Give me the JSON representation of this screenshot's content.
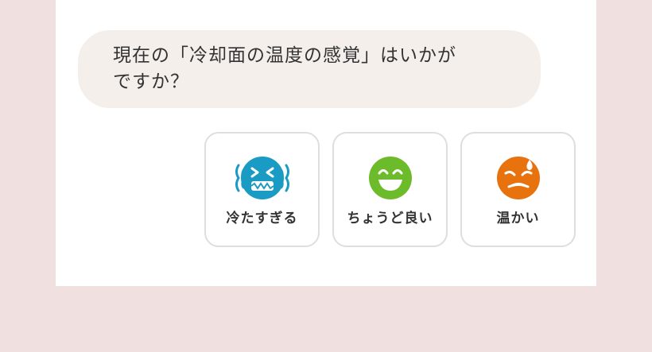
{
  "question": {
    "line1": "現在の「冷却面の温度の感覚」はいかが",
    "line2": "ですか？"
  },
  "options": [
    {
      "label": "冷たすぎる",
      "icon": "freezing-face-icon",
      "color": "#1a9bc4"
    },
    {
      "label": "ちょうど良い",
      "icon": "grinning-face-icon",
      "color": "#6cbb2a"
    },
    {
      "label": "温かい",
      "icon": "sweating-face-icon",
      "color": "#e8730e"
    }
  ]
}
